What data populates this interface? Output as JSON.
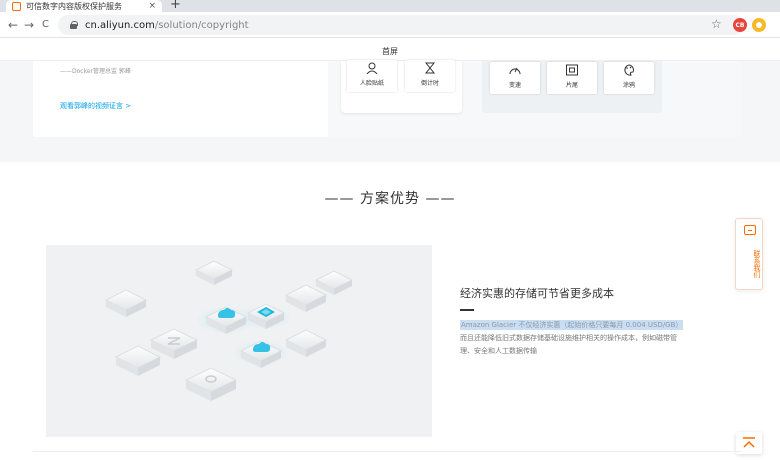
{
  "browser": {
    "tab_title": "可信数字内容版权保护服务",
    "tab_close": "×",
    "new_tab": "+",
    "url_host": "cn.aliyun.com",
    "url_path": "/solution/copyright",
    "back": "←",
    "forward": "→",
    "reload": "C",
    "star": "☆",
    "ext1": "CB"
  },
  "nav": {
    "label": "首屏"
  },
  "upper": {
    "quote_author": "——Docker管理总监 郭峰",
    "video_link": "观看郭峰的视频证言 >",
    "features_a": [
      "人脸贴纸",
      "倒计时"
    ],
    "features_b": [
      "变速",
      "片尾",
      "涂鸦"
    ]
  },
  "section": {
    "title": "—— 方案优势 ——",
    "adv_title": "经济实惠的存储可节省更多成本",
    "adv_highlight": "Amazon Glacier 不仅经济实惠（起始价格只要每月 0.004 USD/GB）",
    "adv_line1": "而且还能降低旧式数据存储基础设施维护相关的操作成本，例如磁带管",
    "adv_line2": "理、安全和人工数据传输"
  },
  "widgets": {
    "contact_text": "联系我们"
  },
  "colors": {
    "accent": "#ff6a00",
    "link": "#00a0e9",
    "cloud": "#34c3e6"
  }
}
